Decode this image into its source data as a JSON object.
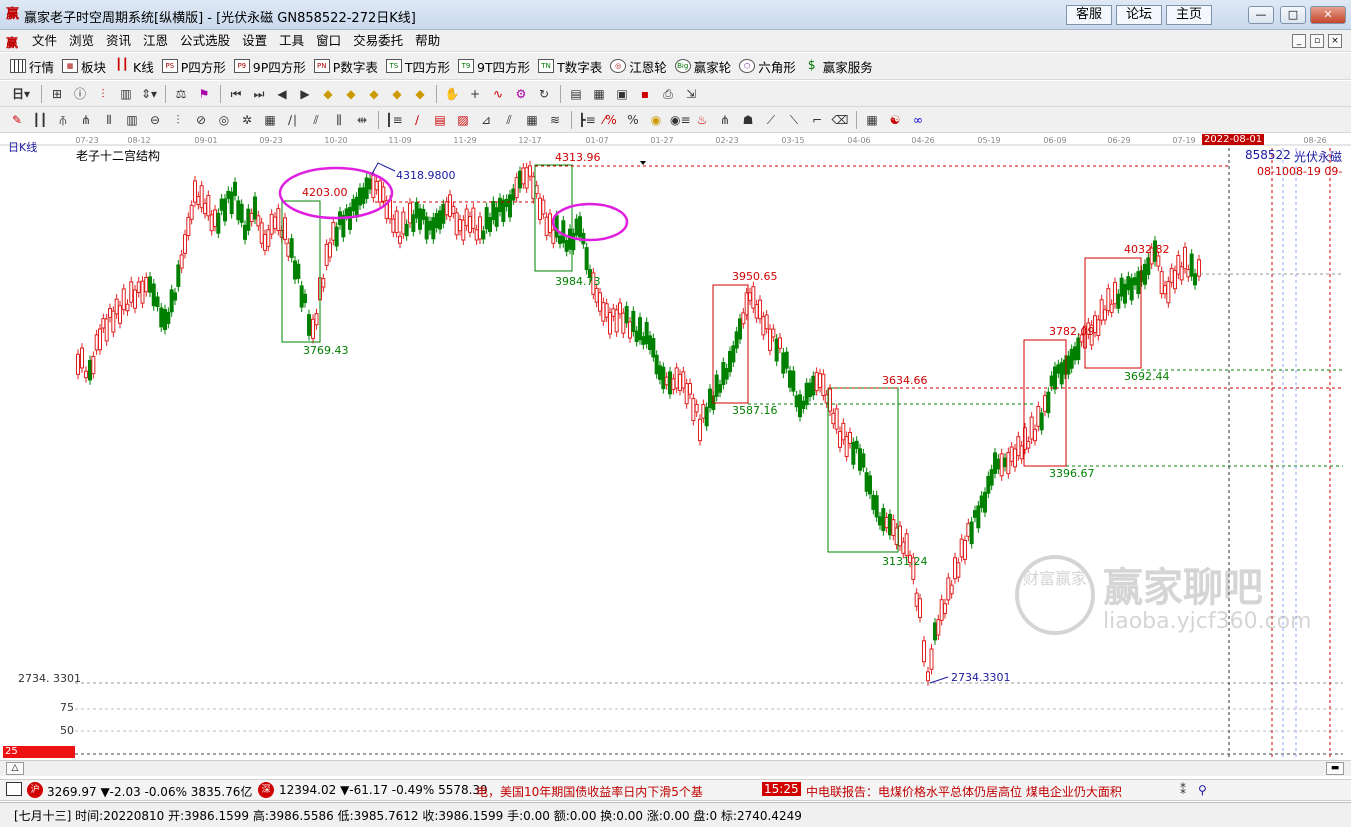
{
  "window": {
    "title": "赢家老子时空周期系统[纵横版] - [光伏永磁  GN858522-272日K线]",
    "links": [
      "客服",
      "论坛",
      "主页"
    ],
    "controls": [
      "—",
      "□",
      "✕"
    ]
  },
  "menu": {
    "items": [
      "文件",
      "浏览",
      "资讯",
      "江恩",
      "公式选股",
      "设置",
      "工具",
      "窗口",
      "交易委托",
      "帮助"
    ]
  },
  "toolbar": {
    "items": [
      {
        "label": "行情",
        "icon": "grid-icon"
      },
      {
        "label": "板块",
        "icon": "block-icon"
      },
      {
        "label": "K线",
        "icon": "candlestick-icon"
      },
      {
        "label": "P四方形",
        "icon": "ps-icon",
        "tag": "PS"
      },
      {
        "label": "9P四方形",
        "icon": "p9-icon",
        "tag": "P9"
      },
      {
        "label": "P数字表",
        "icon": "pn-icon",
        "tag": "PN"
      },
      {
        "label": "T四方形",
        "icon": "ts-icon",
        "tag": "TS"
      },
      {
        "label": "9T四方形",
        "icon": "t9-icon",
        "tag": "T9"
      },
      {
        "label": "T数字表",
        "icon": "tn-icon",
        "tag": "TN"
      },
      {
        "label": "江恩轮",
        "icon": "gann-wheel-icon"
      },
      {
        "label": "赢家轮",
        "icon": "winner-wheel-icon",
        "tag": "Big"
      },
      {
        "label": "六角形",
        "icon": "hexagon-icon"
      },
      {
        "label": "赢家服务",
        "icon": "money-icon",
        "tag": "$"
      }
    ],
    "period_label": "日"
  },
  "chart": {
    "period_title": "日K线",
    "indicator_title": "老子十二宫结构",
    "stock_code": "858522",
    "stock_name": "光伏永磁",
    "highlight_date": "2022-08-01",
    "date_ticks": [
      "07-23",
      "08-12",
      "09-01",
      "09-23",
      "10-20",
      "11-09",
      "11-29",
      "12-17",
      "01-07",
      "01-27",
      "02-23",
      "03-15",
      "04-06",
      "04-26",
      "05-19",
      "06-09",
      "06-29",
      "07-19",
      "08-26"
    ],
    "right_dates": "08-1008-19   09-",
    "low_axis_label": "2734. 3301",
    "axis_values": [
      "75",
      "50"
    ],
    "bottom_box": "25",
    "price_labels": {
      "a4203": "4203.00",
      "a4318": "4318.9800",
      "a4313": "4313.96",
      "a3984": "3984.73",
      "a3769": "3769.43",
      "a3950": "3950.65",
      "a3587": "3587.16",
      "a3634": "3634.66",
      "a3131": "3131.24",
      "a2734": "2734.3301",
      "a3782": "3782.09",
      "a3396": "3396.67",
      "a4032": "4032.82",
      "a3692": "3692.44"
    },
    "watermark": {
      "title": "赢家聊吧",
      "url": "liaoba.yjcf360.com",
      "seal": "财富赢家"
    },
    "colors": {
      "up": "#e02020",
      "down": "#008000",
      "ellipse": "#e020e0",
      "box_green": "#008000",
      "box_red": "#d00000",
      "blue": "#1a1aa0"
    }
  },
  "ticker": {
    "index1": "3269.97 ▼-2.03 -0.06% 3835.76亿",
    "index2": "12394.02 ▼-61.17 -0.49% 5578.39",
    "news1": "电，美国10年期国债收益率日内下滑5个基",
    "time": "15:25",
    "news2": "中电联报告：电煤价格水平总体仍居高位 煤电企业仍大面积"
  },
  "status": {
    "text": "[七月十三] 时间:20220810 开:3986.1599 高:3986.5586 低:3985.7612 收:3986.1599 手:0.00 额:0.00 换:0.00 涨:0.00 盘:0 标:2740.4249"
  }
}
